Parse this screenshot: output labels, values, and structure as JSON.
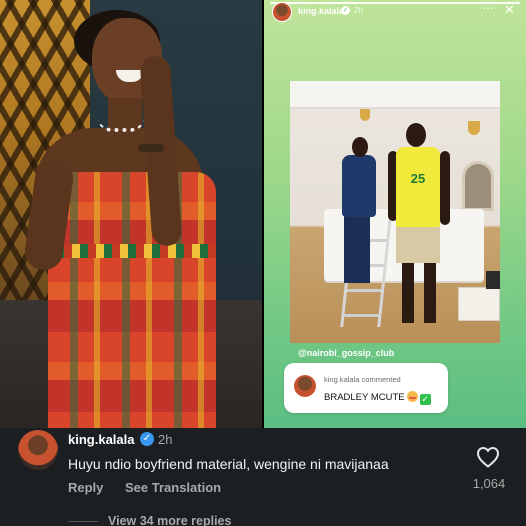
{
  "story": {
    "username": "king.kalala",
    "time": "2h",
    "more_icon": "⋯",
    "close_icon": "✕",
    "jersey_number": "25",
    "mention_tag": "@nairobi_gossip_club",
    "reply_card": {
      "meta": "king.kalala commented",
      "text": "BRADLEY MCUTE"
    }
  },
  "comment": {
    "username": "king.kalala",
    "time": "2h",
    "text": "Huyu ndio boyfriend material, wengine ni mavijanaa",
    "reply_label": "Reply",
    "translate_label": "See Translation",
    "likes": "1,064",
    "view_more_label": "View 34 more replies"
  },
  "colors": {
    "verified_blue": "#3897f0",
    "story_green": "#7ccd86",
    "comment_bg": "#1c1f22"
  },
  "icons": {
    "verified": "verified-badge-icon",
    "heart": "heart-outline-icon",
    "more": "more-options-icon",
    "close": "close-icon"
  }
}
